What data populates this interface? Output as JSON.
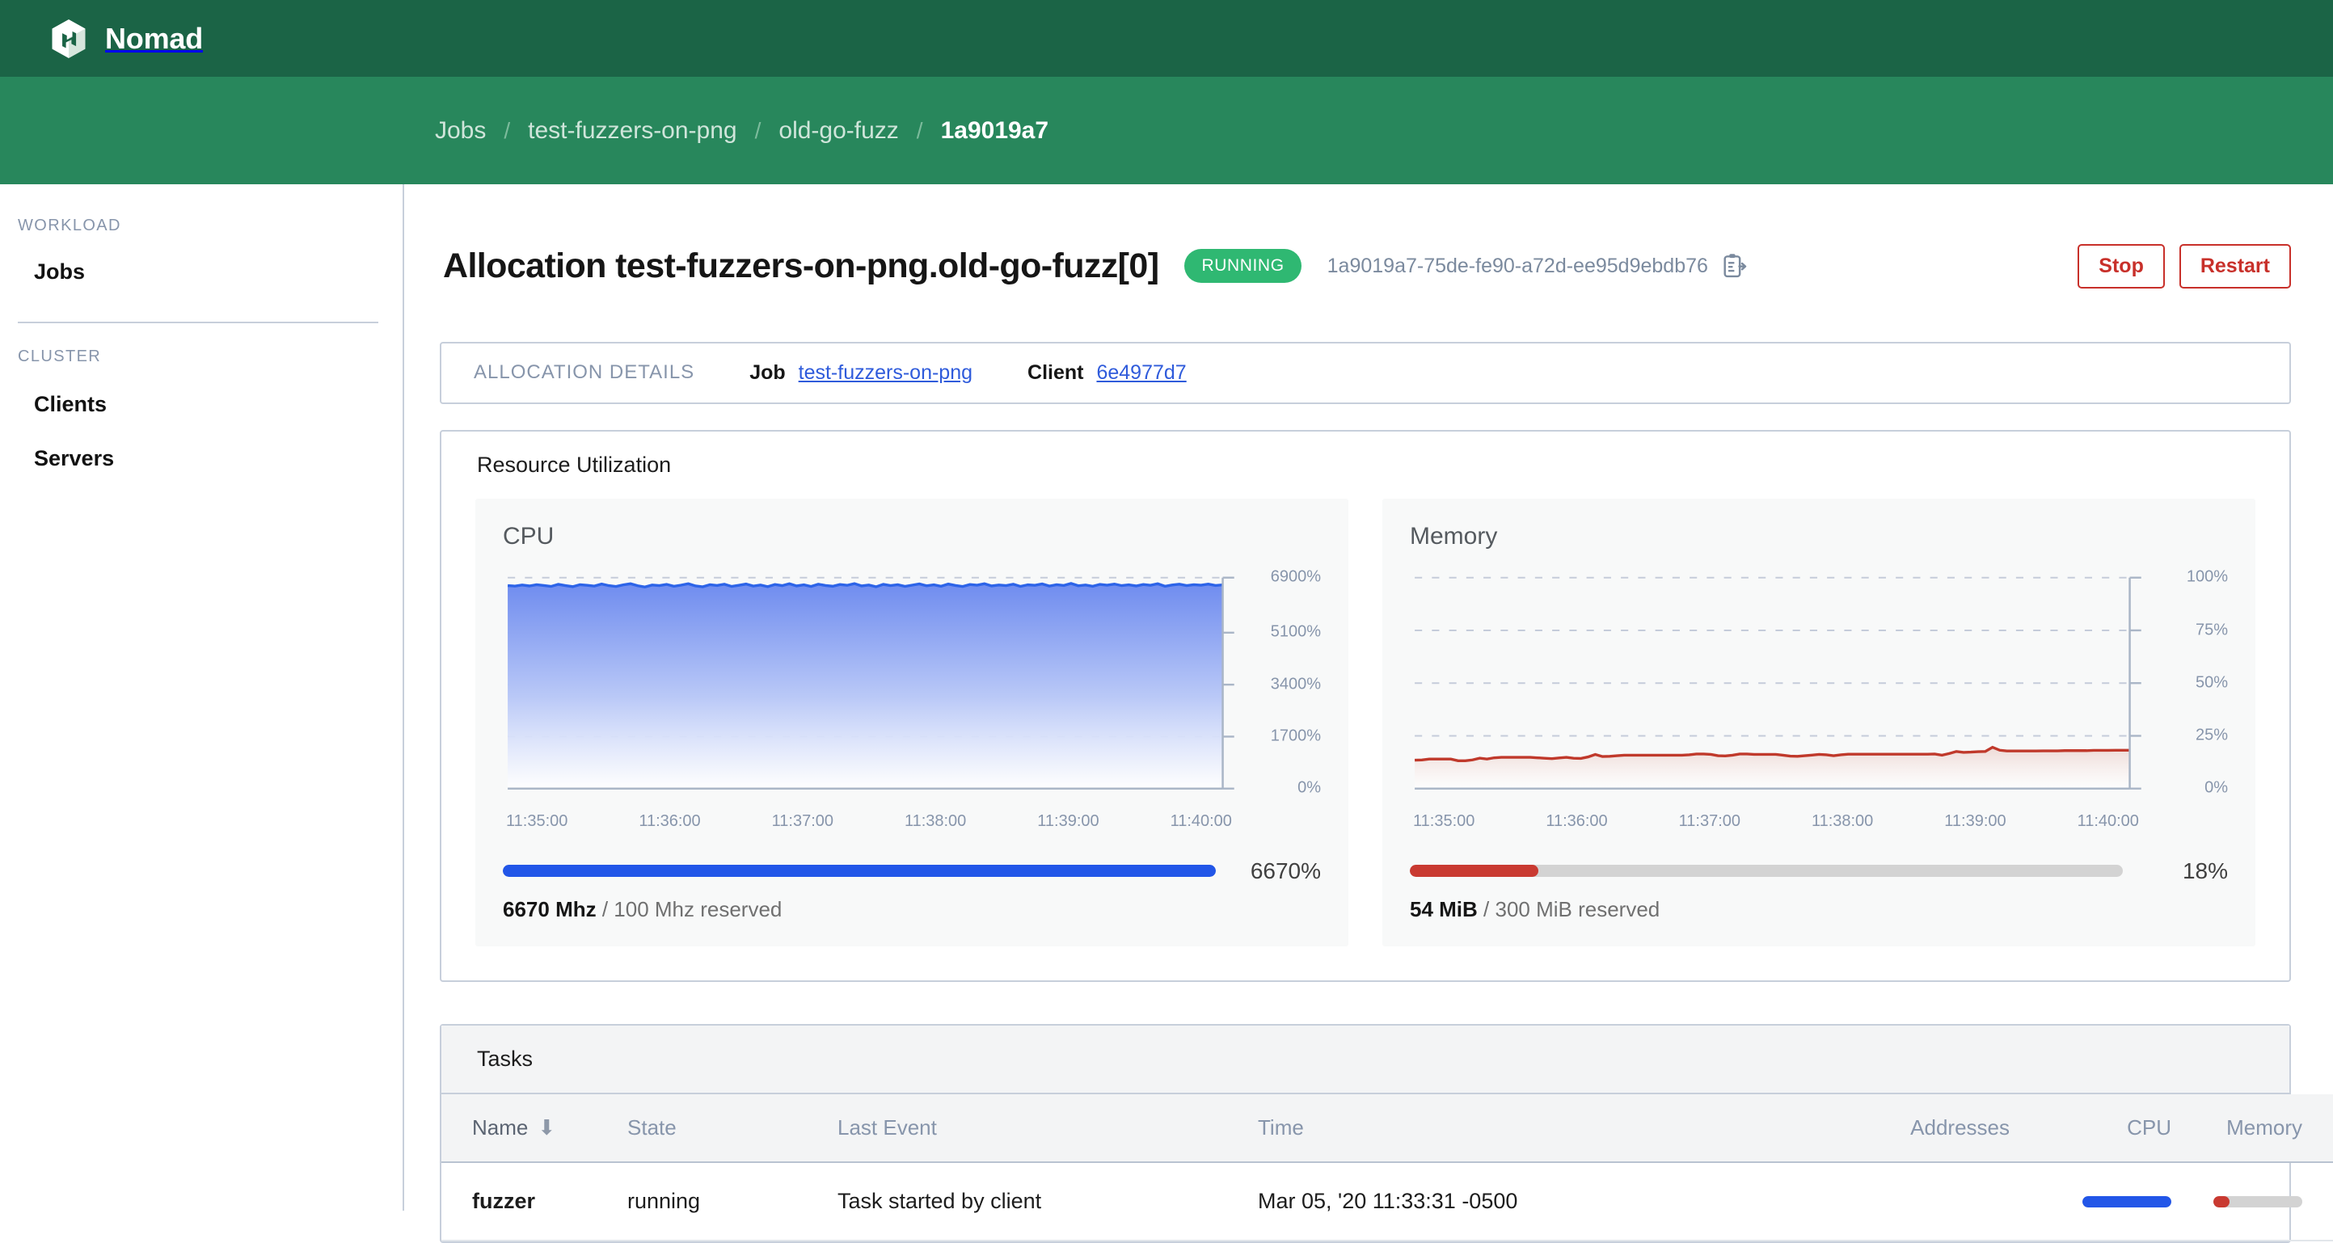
{
  "app": {
    "brand": "Nomad",
    "logo_icon": "nomad-cube-logo"
  },
  "breadcrumbs": [
    {
      "label": "Jobs",
      "current": false
    },
    {
      "label": "test-fuzzers-on-png",
      "current": false
    },
    {
      "label": "old-go-fuzz",
      "current": false
    },
    {
      "label": "1a9019a7",
      "current": true
    }
  ],
  "breadcrumb_separator": "/",
  "sidebar": {
    "sections": [
      {
        "title": "WORKLOAD",
        "items": [
          {
            "label": "Jobs"
          }
        ]
      },
      {
        "title": "CLUSTER",
        "items": [
          {
            "label": "Clients"
          },
          {
            "label": "Servers"
          }
        ]
      }
    ]
  },
  "header": {
    "title": "Allocation test-fuzzers-on-png.old-go-fuzz[0]",
    "status_badge": "RUNNING",
    "allocation_id": "1a9019a7-75de-fe90-a72d-ee95d9ebdb76",
    "copy_icon": "copy-to-clipboard-icon",
    "stop_label": "Stop",
    "restart_label": "Restart"
  },
  "detail_strip": {
    "caption": "ALLOCATION DETAILS",
    "job_key": "Job",
    "job_value": "test-fuzzers-on-png",
    "client_key": "Client",
    "client_value": "6e4977d7"
  },
  "resource_utilization": {
    "title": "Resource Utilization",
    "cpu": {
      "title": "CPU",
      "percent_label": "6670%",
      "used": "6670 Mhz",
      "reserved": " / 100 Mhz reserved",
      "fill_percent": 100
    },
    "memory": {
      "title": "Memory",
      "percent_label": "18%",
      "used": "54 MiB",
      "reserved": " / 300 MiB reserved",
      "fill_percent": 18
    }
  },
  "tasks": {
    "title": "Tasks",
    "columns": [
      {
        "label": "Name",
        "sorted": true,
        "sort_icon": "arrow-down-icon"
      },
      {
        "label": "State",
        "sorted": false
      },
      {
        "label": "Last Event",
        "sorted": false
      },
      {
        "label": "Time",
        "sorted": false
      },
      {
        "label": "Addresses",
        "sorted": false
      },
      {
        "label": "CPU",
        "sorted": false
      },
      {
        "label": "Memory",
        "sorted": false
      }
    ],
    "rows": [
      {
        "name": "fuzzer",
        "state": "running",
        "last_event": "Task started by client",
        "time": "Mar 05, '20 11:33:31 -0500",
        "addresses": "",
        "cpu_percent": 100,
        "memory_percent": 18
      }
    ]
  },
  "colors": {
    "brand_dark_green": "#1b6446",
    "brand_green": "#28875c",
    "status_green": "#2fb872",
    "danger_red": "#c8302a",
    "cpu_blue": "#2256e8",
    "memory_red": "#c93a31",
    "link_blue": "#2f5bdb"
  },
  "chart_data": [
    {
      "type": "area",
      "title": "CPU",
      "xlabel": "",
      "ylabel": "",
      "ylim": [
        0,
        6900
      ],
      "yticks": [
        0,
        1700,
        3400,
        5100,
        6900
      ],
      "ytick_labels": [
        "0%",
        "1700%",
        "3400%",
        "5100%",
        "6900%"
      ],
      "xtick_labels": [
        "11:35:00",
        "11:36:00",
        "11:37:00",
        "11:38:00",
        "11:39:00",
        "11:40:00"
      ],
      "grid": true,
      "legend": "none",
      "unit": "%",
      "line_color": "#2d64e8",
      "fill": "gradient #7b96f0 to #ffffff",
      "values": [
        6640,
        6625,
        6660,
        6630,
        6670,
        6645,
        6615,
        6680,
        6640,
        6605,
        6670,
        6650,
        6625,
        6690,
        6640,
        6610,
        6665,
        6700,
        6635,
        6595,
        6660,
        6640,
        6680,
        6620,
        6655,
        6700,
        6630,
        6600,
        6670,
        6645,
        6685,
        6615,
        6650,
        6690,
        6625,
        6660,
        6605,
        6675,
        6640,
        6700,
        6630,
        6665,
        6610,
        6685,
        6645,
        6620,
        6675,
        6650,
        6705,
        6630,
        6660,
        6600,
        6680,
        6640,
        6670,
        6615,
        6655,
        6695,
        6635,
        6665,
        6620,
        6690,
        6645,
        6610,
        6675,
        6655,
        6700,
        6630,
        6660,
        6640,
        6685,
        6615,
        6665,
        6650,
        6695,
        6625,
        6670,
        6645,
        6710,
        6635,
        6660,
        6620,
        6680,
        6655,
        6690,
        6640,
        6665,
        6630,
        6675,
        6650,
        6700,
        6620,
        6660,
        6685,
        6640,
        6670,
        6655,
        6690,
        6645,
        6665
      ]
    },
    {
      "type": "area",
      "title": "Memory",
      "xlabel": "",
      "ylabel": "",
      "ylim": [
        0,
        100
      ],
      "yticks": [
        0,
        25,
        50,
        75,
        100
      ],
      "ytick_labels": [
        "0%",
        "25%",
        "50%",
        "75%",
        "100%"
      ],
      "xtick_labels": [
        "11:35:00",
        "11:36:00",
        "11:37:00",
        "11:38:00",
        "11:39:00",
        "11:40:00"
      ],
      "grid": true,
      "legend": "none",
      "unit": "%",
      "line_color": "#c0392b",
      "fill": "gradient #f3dcd9 to #ffffff",
      "values": [
        13.5,
        13.6,
        14.0,
        14.0,
        14.0,
        14.0,
        13.2,
        13.2,
        13.6,
        14.4,
        14.0,
        14.6,
        14.8,
        14.8,
        14.8,
        14.8,
        14.8,
        14.6,
        14.4,
        14.2,
        14.5,
        14.8,
        14.4,
        14.3,
        15.0,
        16.2,
        15.2,
        15.3,
        15.6,
        15.8,
        15.8,
        15.8,
        15.8,
        15.8,
        15.8,
        15.8,
        15.8,
        15.8,
        16.0,
        16.4,
        16.4,
        16.2,
        15.6,
        15.5,
        15.8,
        16.4,
        16.4,
        16.2,
        16.2,
        16.2,
        16.2,
        15.8,
        15.4,
        15.3,
        15.6,
        15.9,
        16.2,
        16.0,
        15.6,
        16.0,
        16.3,
        16.3,
        16.3,
        16.3,
        16.3,
        16.3,
        16.3,
        16.3,
        16.3,
        16.3,
        16.3,
        16.3,
        16.4,
        15.8,
        16.6,
        17.6,
        17.2,
        17.3,
        17.5,
        17.6,
        19.6,
        18.2,
        17.8,
        17.8,
        17.8,
        17.8,
        17.8,
        17.9,
        17.9,
        17.9,
        18.0,
        18.0,
        18.0,
        18.0,
        18.1,
        18.1,
        18.1,
        18.2,
        18.2,
        18.2
      ]
    }
  ]
}
